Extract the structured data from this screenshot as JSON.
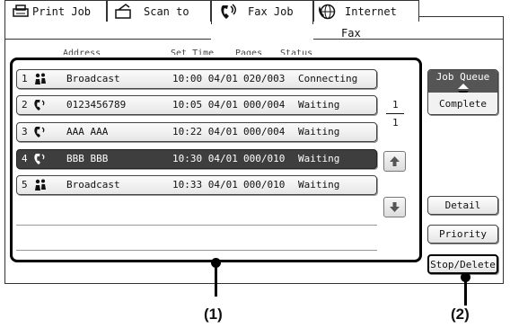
{
  "tabs": [
    {
      "label": "Print Job",
      "icon": "printer-icon"
    },
    {
      "label": "Scan to",
      "icon": "scanner-icon"
    },
    {
      "label": "Fax Job",
      "icon": "fax-icon",
      "active": true
    },
    {
      "label": "Internet Fax",
      "icon": "internet-fax-icon"
    }
  ],
  "columns": [
    "Address",
    "Set Time",
    "Pages",
    "Status"
  ],
  "jobs": [
    {
      "num": "1",
      "icon": "broadcast-icon",
      "address": "Broadcast",
      "time": "10:00 04/01",
      "pages": "020/003",
      "status": "Connecting",
      "selected": false
    },
    {
      "num": "2",
      "icon": "phone-fax-icon",
      "address": "0123456789",
      "time": "10:05 04/01",
      "pages": "000/004",
      "status": "Waiting",
      "selected": false
    },
    {
      "num": "3",
      "icon": "phone-fax-icon",
      "address": "AAA AAA",
      "time": "10:22 04/01",
      "pages": "000/004",
      "status": "Waiting",
      "selected": false
    },
    {
      "num": "4",
      "icon": "phone-fax-icon",
      "address": "BBB BBB",
      "time": "10:30 04/01",
      "pages": "000/010",
      "status": "Waiting",
      "selected": true
    },
    {
      "num": "5",
      "icon": "broadcast-icon",
      "address": "Broadcast",
      "time": "10:33 04/01",
      "pages": "000/010",
      "status": "Waiting",
      "selected": false
    }
  ],
  "pager": {
    "current": "1",
    "total": "1"
  },
  "queue_toggle": {
    "top": "Job Queue",
    "bottom": "Complete"
  },
  "buttons": {
    "detail": "Detail",
    "priority": "Priority",
    "stop_delete": "Stop/Delete"
  },
  "callouts": {
    "one": "(1)",
    "two": "(2)"
  }
}
